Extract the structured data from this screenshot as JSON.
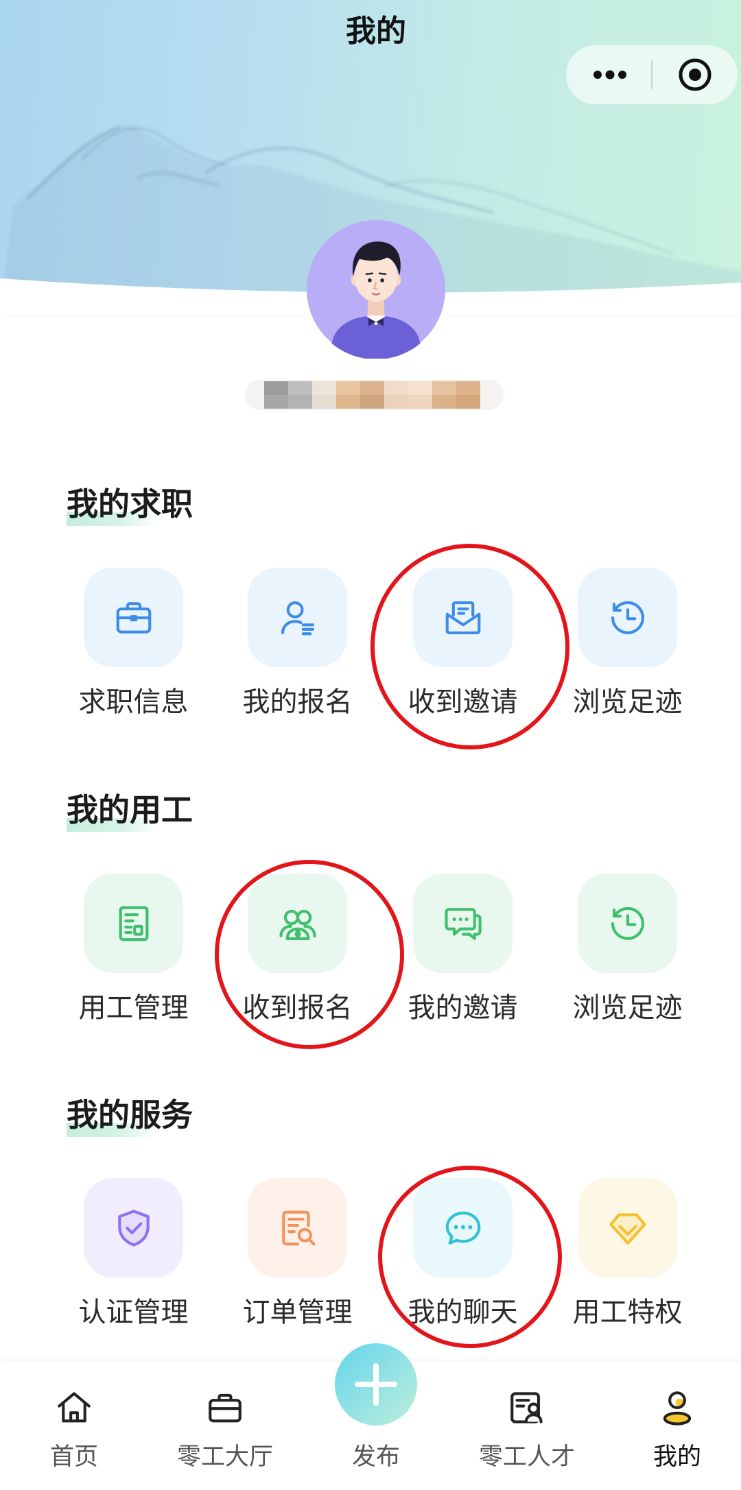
{
  "header": {
    "title": "我的",
    "capsule": {
      "more_icon": "more-dots-icon",
      "close_icon": "target-icon"
    }
  },
  "profile": {
    "avatar": "avatar-man-icon"
  },
  "sections": [
    {
      "title": "我的求职",
      "accent": "#3d8ce8",
      "tile_bg": "#eaf4fd",
      "items": [
        {
          "label": "求职信息",
          "icon": "briefcase-icon"
        },
        {
          "label": "我的报名",
          "icon": "user-list-icon"
        },
        {
          "label": "收到邀请",
          "icon": "envelope-icon",
          "circled": true
        },
        {
          "label": "浏览足迹",
          "icon": "history-icon"
        }
      ]
    },
    {
      "title": "我的用工",
      "accent": "#3fbf6d",
      "tile_bg": "#e9f8ef",
      "items": [
        {
          "label": "用工管理",
          "icon": "document-icon"
        },
        {
          "label": "收到报名",
          "icon": "group-icon",
          "circled": true
        },
        {
          "label": "我的邀请",
          "icon": "chat-bubbles-icon"
        },
        {
          "label": "浏览足迹",
          "icon": "history-icon"
        }
      ]
    },
    {
      "title": "我的服务",
      "items": [
        {
          "label": "认证管理",
          "icon": "shield-check-icon",
          "accent": "#8c72f0",
          "tile_bg": "#f2edfd"
        },
        {
          "label": "订单管理",
          "icon": "order-search-icon",
          "accent": "#f0935c",
          "tile_bg": "#fdf1ea"
        },
        {
          "label": "我的聊天",
          "icon": "chat-icon",
          "accent": "#2fc1d8",
          "tile_bg": "#e8f8fb",
          "circled": true
        },
        {
          "label": "用工特权",
          "icon": "diamond-icon",
          "accent": "#f4c02f",
          "tile_bg": "#fdf8e6"
        }
      ]
    }
  ],
  "annotation_color": "#e3151b",
  "tabbar": {
    "tabs": [
      {
        "label": "首页",
        "icon": "home-icon"
      },
      {
        "label": "零工大厅",
        "icon": "briefcase-icon"
      },
      {
        "label": "发布",
        "icon": "plus-icon"
      },
      {
        "label": "零工人才",
        "icon": "talent-card-icon"
      },
      {
        "label": "我的",
        "icon": "profile-icon",
        "active": true
      }
    ],
    "active_accent": "#f5c532"
  }
}
